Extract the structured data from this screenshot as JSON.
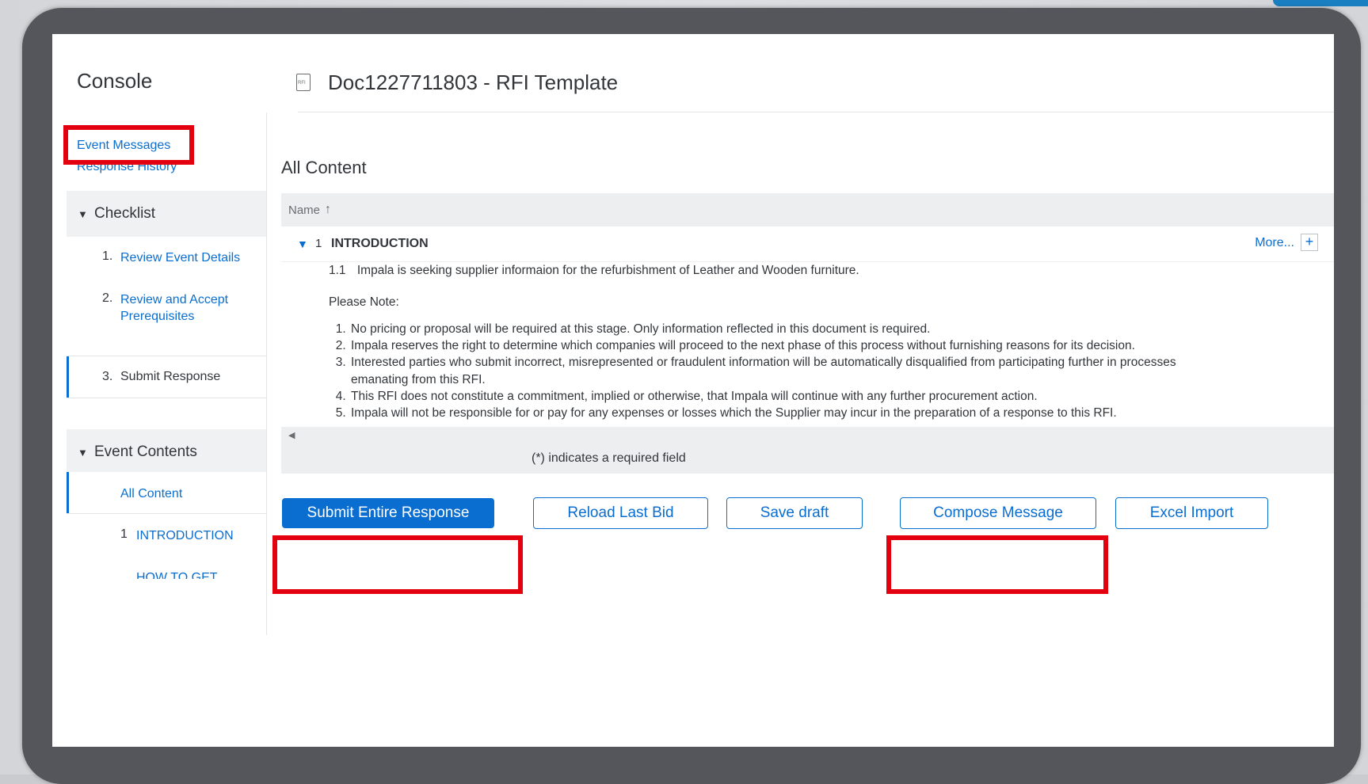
{
  "console_title": "Console",
  "document": {
    "icon": "rfi-document-icon",
    "title": "Doc1227711803 - RFI Template"
  },
  "nav": {
    "event_messages": "Event Messages",
    "response_history": "Response History",
    "checklist": {
      "label": "Checklist",
      "items": [
        {
          "num": "1.",
          "label": "Review Event Details"
        },
        {
          "num": "2.",
          "label": "Review and Accept Prerequisites"
        },
        {
          "num": "3.",
          "label": "Submit Response"
        }
      ]
    },
    "event_contents": {
      "label": "Event Contents",
      "items": [
        {
          "num": "",
          "label": "All Content"
        },
        {
          "num": "1",
          "label": "INTRODUCTION"
        },
        {
          "num": "",
          "label": "HOW TO GET"
        }
      ]
    }
  },
  "main": {
    "section_title": "All Content",
    "table_header": {
      "name": "Name",
      "sort_icon": "↑"
    },
    "section": {
      "num": "1",
      "name": "INTRODUCTION",
      "more": "More...",
      "plus": "+"
    },
    "item": {
      "num": "1.1",
      "text": "Impala is seeking supplier informaion for the refurbishment of Leather and Wooden furniture."
    },
    "note_label": "Please Note:",
    "notes": [
      "No pricing or proposal will be required at this stage. Only information reflected in this document is required.",
      "Impala reserves the right to determine which companies will proceed to the next phase of this process without furnishing reasons for its decision.",
      "Interested parties who submit incorrect, misrepresented or fraudulent information will be automatically disqualified from participating further in processes emanating from this RFI.",
      "This RFI does not constitute a commitment, implied or otherwise, that Impala will continue with any further procurement action.",
      "Impala will not be responsible for or pay for any expenses or losses which the Supplier may incur in the preparation of a response to this RFI."
    ],
    "required_note": "(*) indicates a required field"
  },
  "buttons": {
    "submit": "Submit Entire Response",
    "reload": "Reload Last Bid",
    "save": "Save draft",
    "compose": "Compose Message",
    "excel": "Excel Import"
  },
  "colors": {
    "accent": "#0a6ed1",
    "highlight": "#e3000f",
    "frame": "#54565b"
  }
}
